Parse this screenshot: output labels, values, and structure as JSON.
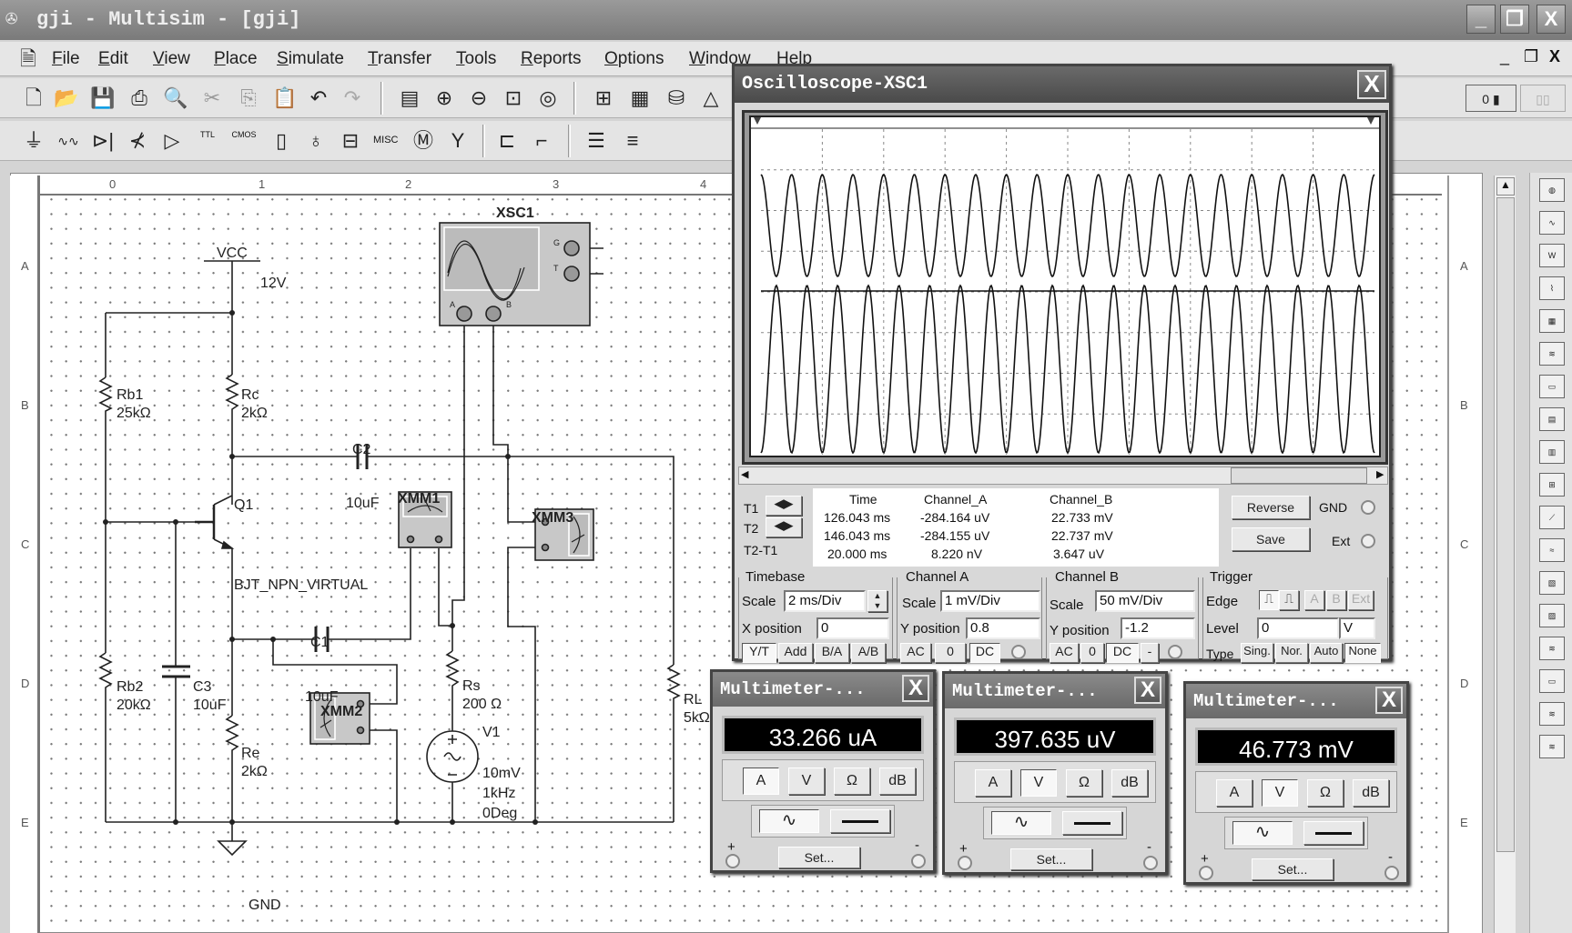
{
  "window": {
    "title": "gji - Multisim - [gji]",
    "minimize": "_",
    "restore": "❐",
    "close": "X"
  },
  "menu": [
    "File",
    "Edit",
    "View",
    "Place",
    "Simulate",
    "Transfer",
    "Tools",
    "Reports",
    "Options",
    "Window",
    "Help"
  ],
  "mdi": {
    "minimize": "_",
    "restore": "❐",
    "close": "X"
  },
  "toolbar2_text": {
    "ttl": "TTL",
    "cmos": "CMOS",
    "misc": "MISC"
  },
  "ruler": {
    "cols": [
      "0",
      "1",
      "2",
      "3",
      "4"
    ],
    "rows": [
      "A",
      "B",
      "C",
      "D",
      "E"
    ]
  },
  "circuit": {
    "vcc": {
      "name": "VCC",
      "value": "12V"
    },
    "rb1": {
      "name": "Rb1",
      "value": "25kΩ"
    },
    "rc": {
      "name": "Rc",
      "value": "2kΩ"
    },
    "rb2": {
      "name": "Rb2",
      "value": "20kΩ"
    },
    "re": {
      "name": "Re",
      "value": "2kΩ"
    },
    "rs": {
      "name": "Rs",
      "value": "200 Ω"
    },
    "rl": {
      "name": "RL",
      "value": "5kΩ"
    },
    "c1": {
      "name": "C1",
      "value": "10uF"
    },
    "c2": {
      "name": "C2",
      "value": "10uF"
    },
    "c3": {
      "name": "C3",
      "value": "10uF"
    },
    "q1": {
      "name": "Q1",
      "model": "BJT_NPN_VIRTUAL"
    },
    "v1": {
      "name": "V1",
      "amplitude": "10mV",
      "freq": "1kHz",
      "phase": "0Deg"
    },
    "gnd": "GND",
    "xsc1": {
      "name": "XSC1",
      "pins": {
        "a": "A",
        "b": "B",
        "g": "G",
        "t": "T"
      }
    },
    "xmm1": "XMM1",
    "xmm2": "XMM2",
    "xmm3": "XMM3"
  },
  "oscilloscope": {
    "title": "Oscilloscope-XSC1",
    "close": "X",
    "cursors": {
      "headers": [
        "Time",
        "Channel_A",
        "Channel_B"
      ],
      "rows": [
        {
          "label": "T1",
          "time": "126.043 ms",
          "a": "-284.164 uV",
          "b": "22.733 mV"
        },
        {
          "label": "T2",
          "time": "146.043 ms",
          "a": "-284.155 uV",
          "b": "22.737 mV"
        },
        {
          "label": "T2-T1",
          "time": "20.000 ms",
          "a": "8.220 nV",
          "b": "3.647 uV"
        }
      ],
      "arrows": "◀▶"
    },
    "reverse": "Reverse",
    "save": "Save",
    "gnd": "GND",
    "ext": "Ext",
    "timebase": {
      "title": "Timebase",
      "scale_label": "Scale",
      "scale": "2 ms/Div",
      "xpos_label": "X position",
      "xpos": "0",
      "modes": [
        "Y/T",
        "Add",
        "B/A",
        "A/B"
      ]
    },
    "channel_a": {
      "title": "Channel A",
      "scale_label": "Scale",
      "scale": "1 mV/Div",
      "ypos_label": "Y position",
      "ypos": "0.8",
      "coupling": [
        "AC",
        "0",
        "DC"
      ]
    },
    "channel_b": {
      "title": "Channel B",
      "scale_label": "Scale",
      "scale": "50 mV/Div",
      "ypos_label": "Y position",
      "ypos": "-1.2",
      "coupling": [
        "AC",
        "0",
        "DC",
        "-"
      ]
    },
    "trigger": {
      "title": "Trigger",
      "edge_label": "Edge",
      "edges": [
        "A",
        "B",
        "Ext"
      ],
      "level_label": "Level",
      "level": "0",
      "level_unit": "V",
      "type_label": "Type",
      "types": [
        "Sing.",
        "Nor.",
        "Auto",
        "None"
      ]
    }
  },
  "multimeters": [
    {
      "title": "Multimeter-...",
      "reading": "33.266 uA",
      "mode": "A"
    },
    {
      "title": "Multimeter-...",
      "reading": "397.635 uV",
      "mode": "V"
    },
    {
      "title": "Multimeter-...",
      "reading": "46.773 mV",
      "mode": "V"
    }
  ],
  "multimeter_ui": {
    "modes": [
      "A",
      "V",
      "Ω",
      "dB"
    ],
    "set": "Set...",
    "plus": "+",
    "minus": "-",
    "close": "X"
  }
}
